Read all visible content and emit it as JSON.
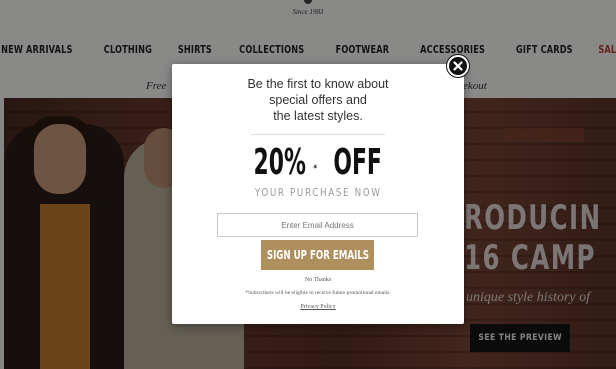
{
  "header": {
    "since": "Since 1983",
    "nav": [
      "NEW ARRIVALS",
      "CLOTHING",
      "SHIRTS",
      "COLLECTIONS",
      "FOOTWEAR",
      "ACCESSORIES",
      "GIFT CARDS",
      "SALE"
    ],
    "promo_left": "Free",
    "promo_right": "ekout"
  },
  "hero": {
    "title_line1": "RODUCIN",
    "title_line2": "16 CAMP",
    "subtitle": "unique style history of",
    "cta": "SEE THE PREVIEW"
  },
  "modal": {
    "heading": [
      "Be the first to know about",
      "special offers and",
      "the latest styles."
    ],
    "offer_main": "20%",
    "offer_sup": "*",
    "offer_word": "OFF",
    "offer_sub": "YOUR PURCHASE NOW",
    "email_placeholder": "Enter Email Address",
    "signup_button": "SIGN UP FOR EMAILS",
    "no_thanks": "No Thanks",
    "disclaimer": "*Subscribers will be eligible to receive future promotional emails.",
    "privacy": "Privacy Policy"
  },
  "colors": {
    "button": "#b08f5e",
    "sale": "#c0392b"
  }
}
